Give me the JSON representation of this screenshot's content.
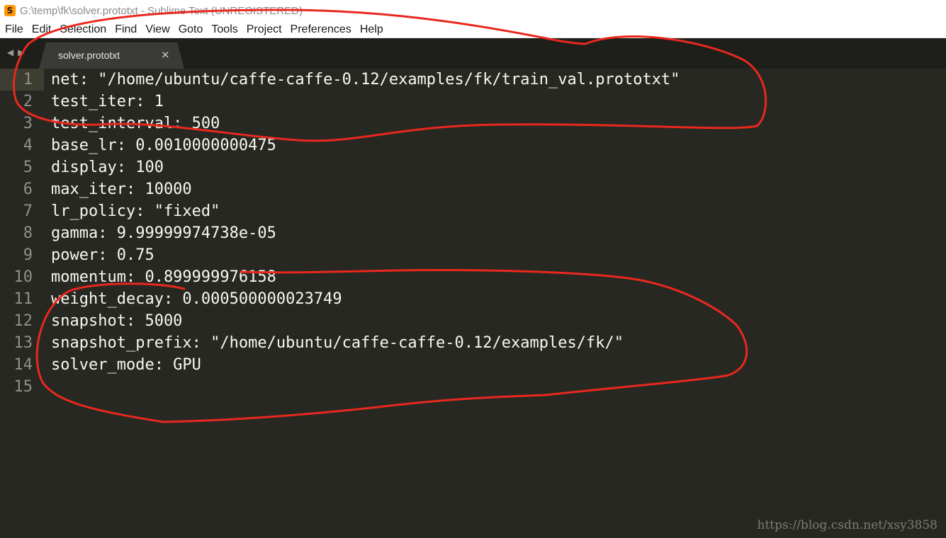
{
  "window": {
    "title": "G:\\temp\\fk\\solver.prototxt - Sublime Text (UNREGISTERED)",
    "app_icon": "S"
  },
  "menu": [
    "File",
    "Edit",
    "Selection",
    "Find",
    "View",
    "Goto",
    "Tools",
    "Project",
    "Preferences",
    "Help"
  ],
  "tab": {
    "label": "solver.prototxt",
    "close": "×",
    "nav_left": "◀",
    "nav_right": "▶"
  },
  "editor": {
    "lines": [
      {
        "num": "1",
        "text": "net: \"/home/ubuntu/caffe-caffe-0.12/examples/fk/train_val.prototxt\""
      },
      {
        "num": "2",
        "text": "test_iter: 1"
      },
      {
        "num": "3",
        "text": "test_interval: 500"
      },
      {
        "num": "4",
        "text": "base_lr: 0.0010000000475"
      },
      {
        "num": "5",
        "text": "display: 100"
      },
      {
        "num": "6",
        "text": "max_iter: 10000"
      },
      {
        "num": "7",
        "text": "lr_policy: \"fixed\""
      },
      {
        "num": "8",
        "text": "gamma: 9.99999974738e-05"
      },
      {
        "num": "9",
        "text": "power: 0.75"
      },
      {
        "num": "10",
        "text": "momentum: 0.899999976158"
      },
      {
        "num": "11",
        "text": "weight_decay: 0.000500000023749"
      },
      {
        "num": "12",
        "text": "snapshot: 5000"
      },
      {
        "num": "13",
        "text": "snapshot_prefix: \"/home/ubuntu/caffe-caffe-0.12/examples/fk/\""
      },
      {
        "num": "14",
        "text": "solver_mode: GPU"
      },
      {
        "num": "15",
        "text": ""
      }
    ]
  },
  "watermark": "https://blog.csdn.net/xsy3858",
  "colors": {
    "editor_bg": "#272822",
    "annotation": "#e8281e"
  }
}
